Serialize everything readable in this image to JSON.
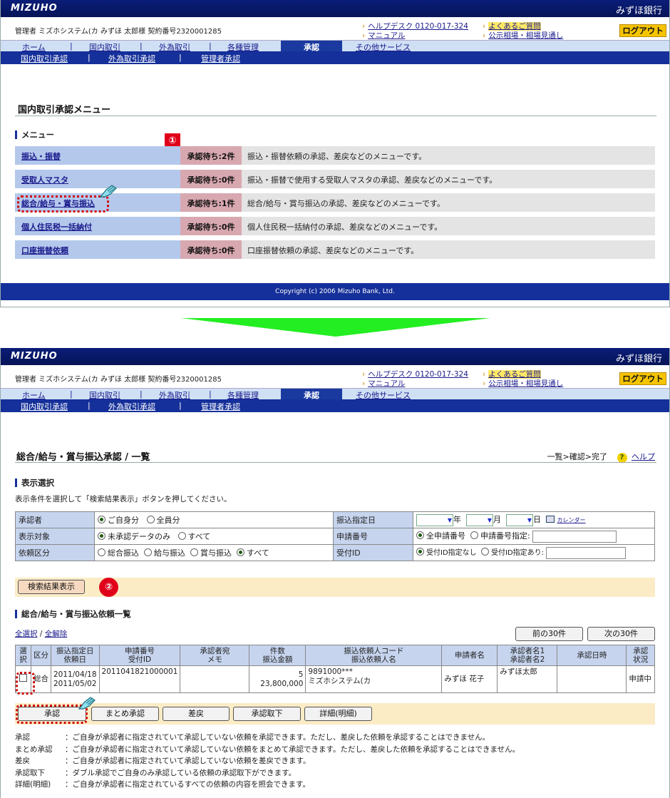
{
  "header": {
    "logo": "MIZUHO",
    "bank_name": "みずほ銀行",
    "user_info": "管理者 ミズホシステム(カ みずほ 太郎様 契約番号2320001285",
    "helpdesk": "ヘルプデスク 0120-017-324",
    "manual": "マニュアル",
    "faq": "よくあるご質問",
    "rates": "公示相場・相場見通し",
    "logout": "ログアウト"
  },
  "nav": {
    "home": "ホーム",
    "domestic": "国内取引",
    "foreign": "外為取引",
    "admin": "各種管理",
    "approval": "承認",
    "other": "その他サービス",
    "sep": "|"
  },
  "subnav": {
    "domestic": "国内取引承認",
    "foreign": "外為取引承認",
    "admin": "管理者承認",
    "sep": "|"
  },
  "footer": {
    "copyright": "Copyright (c) 2006 Mizuho Bank, Ltd."
  },
  "screen1": {
    "title": "国内取引承認メニュー",
    "section": "メニュー",
    "badge": "①",
    "items": [
      {
        "name": "振込・振替",
        "wait": "承認待ち:2件",
        "desc": "振込・振替依頼の承認、差戻などのメニューです。"
      },
      {
        "name": "受取人マスタ",
        "wait": "承認待ち:0件",
        "desc": "振込・振替で使用する受取人マスタの承認、差戻などのメニューです。"
      },
      {
        "name": "総合/給与・賞与振込",
        "wait": "承認待ち:1件",
        "desc": "総合/給与・賞与振込の承認、差戻などのメニューです。"
      },
      {
        "name": "個人住民税一括納付",
        "wait": "承認待ち:0件",
        "desc": "個人住民税一括納付の承認、差戻などのメニューです。"
      },
      {
        "name": "口座振替依頼",
        "wait": "承認待ち:0件",
        "desc": "口座振替依頼の承認、差戻などのメニューです。"
      }
    ]
  },
  "screen2": {
    "title": "総合/給与・賞与振込承認 / 一覧",
    "flow": "一覧>確認>完了",
    "help": "ヘルプ",
    "help_icon": "?",
    "section1": "表示選択",
    "instruction": "表示条件を選択して「検索結果表示」ボタンを押してください。",
    "conditions": {
      "approver_label": "承認者",
      "approver_opts": [
        "ご自身分",
        "全員分"
      ],
      "target_label": "表示対象",
      "target_opts": [
        "未承認データのみ",
        "すべて"
      ],
      "type_label": "依頼区分",
      "type_opts": [
        "総合振込",
        "給与振込",
        "賞与振込",
        "すべて"
      ],
      "date_label": "振込指定日",
      "year": "年",
      "month": "月",
      "day": "日",
      "calendar": "カレンダー",
      "appno_label": "申請番号",
      "appno_opts": [
        "全申請番号",
        "申請番号指定:"
      ],
      "recid_label": "受付ID",
      "recid_opts": [
        "受付ID指定なし",
        "受付ID指定あり:"
      ]
    },
    "search_button": "検索結果表示",
    "badge2": "②",
    "section2": "総合/給与・賞与振込依頼一覧",
    "select_all": "全選択",
    "clear_all": "全解除",
    "slash": "/",
    "prev30": "前の30件",
    "next30": "次の30件",
    "columns": [
      "選択",
      "区分",
      "振込指定日",
      "依頼日",
      "申請番号",
      "受付ID",
      "承認者宛",
      "メモ",
      "件数",
      "振込金額",
      "振込依頼人コード",
      "振込依頼人名",
      "申請者名",
      "承認者名1",
      "承認者名2",
      "承認日時",
      "承認",
      "状況"
    ],
    "row": {
      "kubun": "総合",
      "date1": "2011/04/18",
      "date2": "2011/05/02",
      "appno": "2011041821000001",
      "count": "5",
      "amount": "23,800,000",
      "code": "9891000***",
      "requester": "ミズホシステム(カ",
      "applicant": "みずほ 花子",
      "approver1": "みずほ太郎",
      "status": "申請中"
    },
    "actions": [
      "承認",
      "まとめ承認",
      "差戻",
      "承認取下",
      "詳細(明細)"
    ],
    "legend": [
      {
        "k": "承認",
        "v": "：ご自身が承認者に指定されていて承認していない依頼を承認できます。ただし、差戻した依頼を承認することはできません。"
      },
      {
        "k": "まとめ承認",
        "v": "：ご自身が承認者に指定されていて承認していない依頼をまとめて承認できます。ただし、差戻した依頼を承認することはできません。"
      },
      {
        "k": "差戻",
        "v": "：ご自身が承認者に指定されていて承認していない依頼を差戻できます。"
      },
      {
        "k": "承認取下",
        "v": "：ダブル承認でご自身のみ承認している依頼の承認取下ができます。"
      },
      {
        "k": "詳細(明細)",
        "v": "：ご自身が承認者に指定されているすべての依頼の内容を照会できます。"
      }
    ]
  },
  "colors": {
    "navy": "#15309a",
    "arrow": "#22ee22",
    "badge": "#e0001a",
    "menu_label": "#b4c8ec",
    "wait_cell": "#d8a8b0"
  }
}
